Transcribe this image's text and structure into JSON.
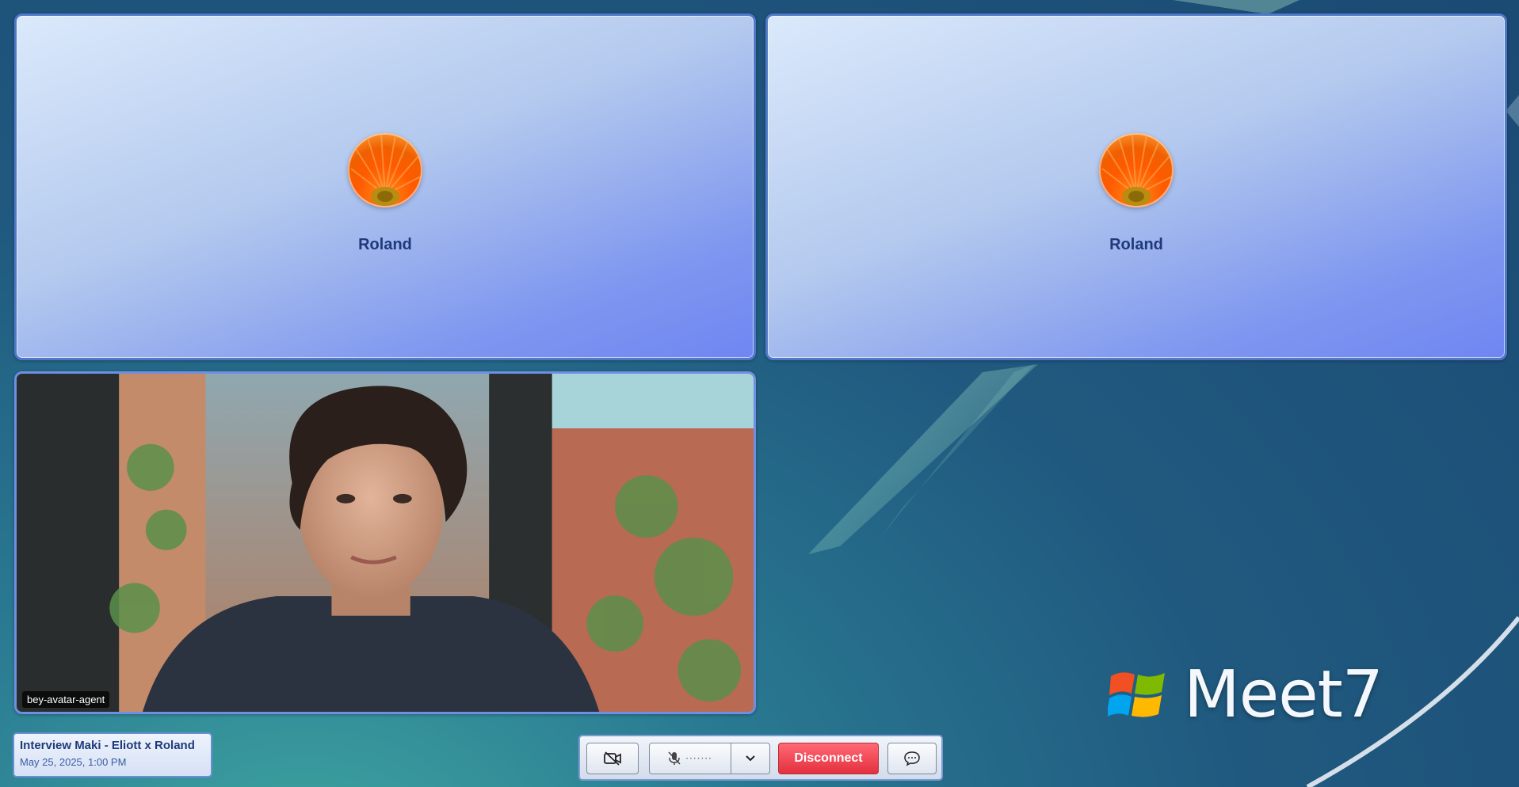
{
  "participants": [
    {
      "name": "Roland",
      "avatar": "orange-flower-avatar"
    },
    {
      "name": "Roland",
      "avatar": "orange-flower-avatar"
    }
  ],
  "video": {
    "label": "bey-avatar-agent"
  },
  "meeting": {
    "title": "Interview Maki - Eliott x Roland",
    "date": "May 25, 2025, 1:00 PM"
  },
  "toolbar": {
    "camera_icon": "camera-off-icon",
    "mic_icon": "mic-muted-icon",
    "mic_level": "·······",
    "dropdown_icon": "chevron-down-icon",
    "disconnect_label": "Disconnect",
    "chat_icon": "chat-bubble-icon"
  },
  "brand": {
    "name": "Meet7"
  },
  "colors": {
    "tile_border": "#4f78c9",
    "disconnect": "#e4303f",
    "title_text": "#1f3a7a"
  }
}
